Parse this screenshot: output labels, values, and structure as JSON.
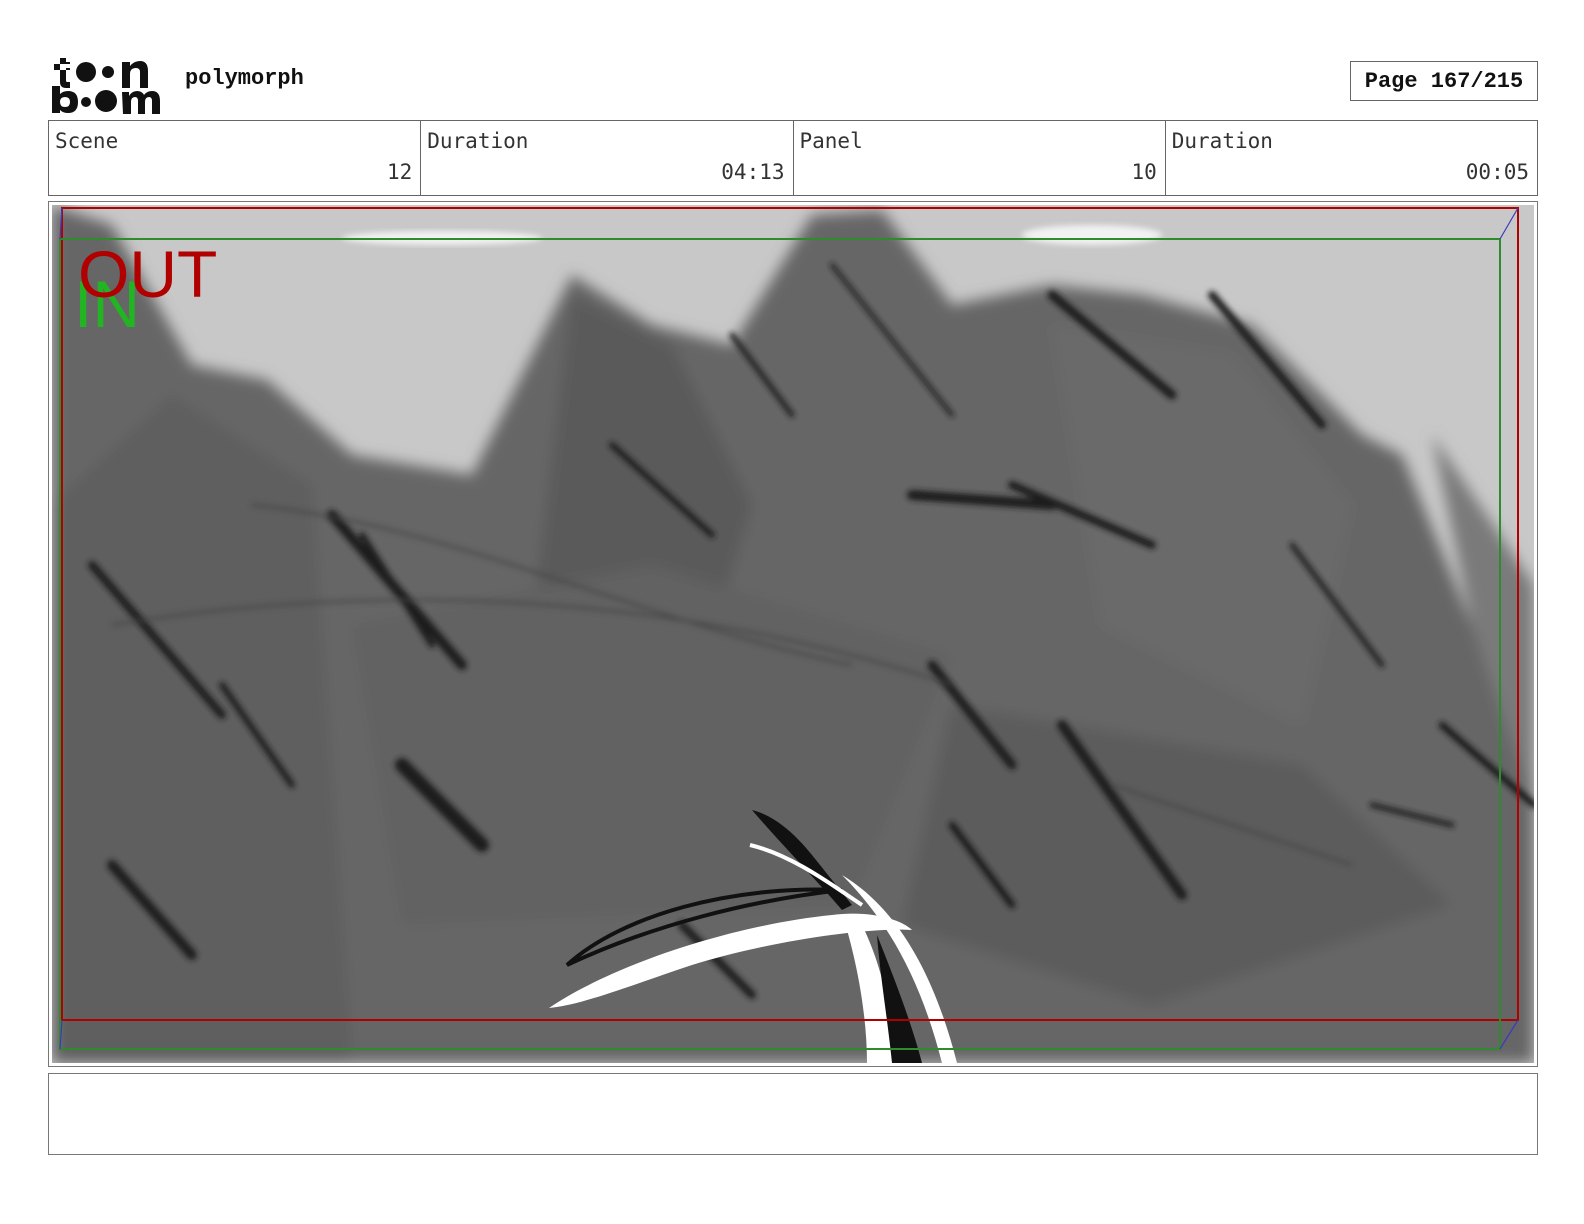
{
  "header": {
    "logo_text": "toon boom",
    "project": "polymorph",
    "page_label": "Page 167/215"
  },
  "info": {
    "scene_label": "Scene",
    "scene_value": "12",
    "scene_duration_label": "Duration",
    "scene_duration_value": "04:13",
    "panel_label": "Panel",
    "panel_value": "10",
    "panel_duration_label": "Duration",
    "panel_duration_value": "00:05"
  },
  "panel": {
    "out_marker": "OUT",
    "in_marker": "IN",
    "colors": {
      "out_frame": "#b00000",
      "in_frame": "#2e8b2e",
      "sky": "#c8c8c8",
      "rock": "#666666"
    }
  },
  "notes": {
    "text": ""
  }
}
